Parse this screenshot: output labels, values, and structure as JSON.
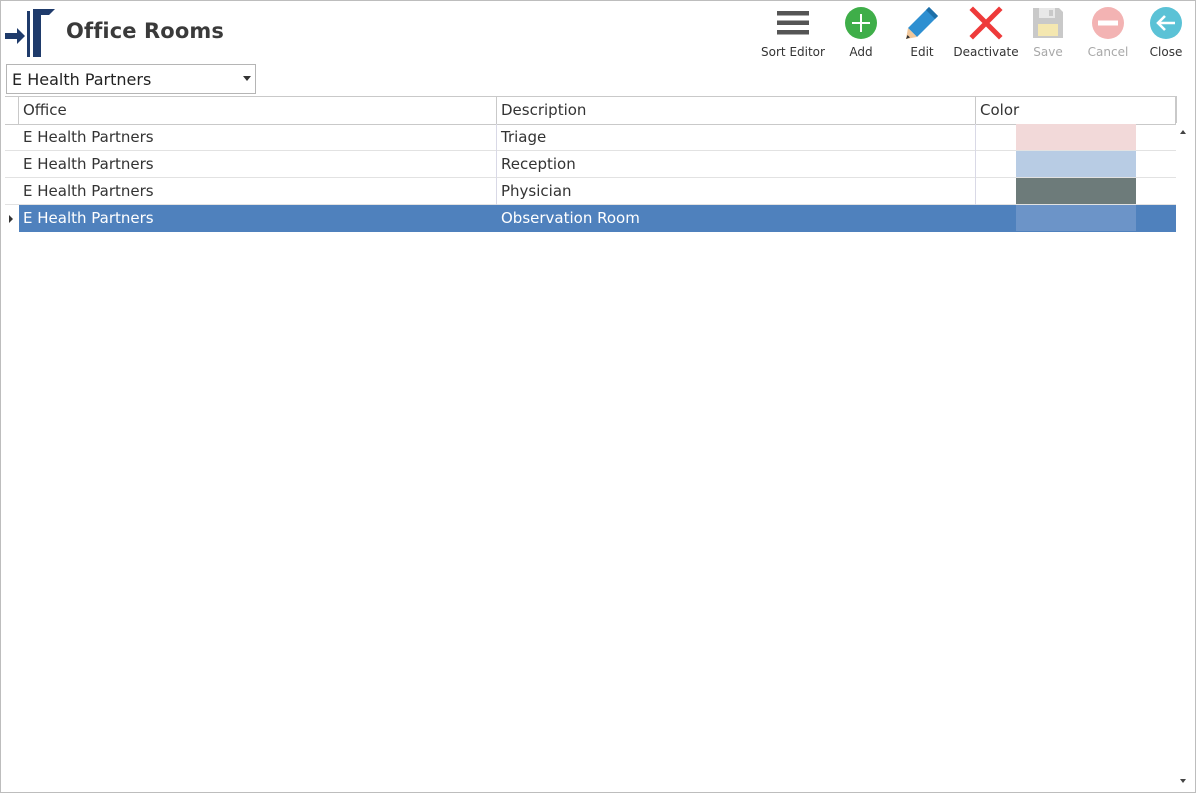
{
  "window": {
    "title": "Office Rooms"
  },
  "toolbar": {
    "sort_editor": {
      "label": "Sort Editor",
      "icon": "hamburger-icon",
      "enabled": true
    },
    "add": {
      "label": "Add",
      "icon": "plus-circle-icon",
      "color": "#3fae49",
      "enabled": true
    },
    "edit": {
      "label": "Edit",
      "icon": "pencil-icon",
      "color": "#2e8fd1",
      "enabled": true
    },
    "deactivate": {
      "label": "Deactivate",
      "icon": "x-mark-icon",
      "color": "#ee3a3a",
      "enabled": true
    },
    "save": {
      "label": "Save",
      "icon": "floppy-disk-icon",
      "enabled": false
    },
    "cancel": {
      "label": "Cancel",
      "icon": "minus-circle-icon",
      "color": "#f3b3b3",
      "enabled": false
    },
    "close": {
      "label": "Close",
      "icon": "arrow-left-circle-icon",
      "color": "#5bc2d6",
      "enabled": true
    }
  },
  "office_select": {
    "value": "E Health Partners"
  },
  "grid": {
    "columns": [
      "Office",
      "Description",
      "Color"
    ],
    "rows": [
      {
        "office": "E Health Partners",
        "description": "Triage",
        "color": "#f2d9d9",
        "selected": false
      },
      {
        "office": "E Health Partners",
        "description": "Reception",
        "color": "#b8cce4",
        "selected": false
      },
      {
        "office": "E Health Partners",
        "description": "Physician",
        "color": "#6d7b7a",
        "selected": false
      },
      {
        "office": "E Health Partners",
        "description": "Observation Room",
        "color": "#6c94c8",
        "selected": true
      }
    ],
    "selection_color": "#4f81bd"
  }
}
